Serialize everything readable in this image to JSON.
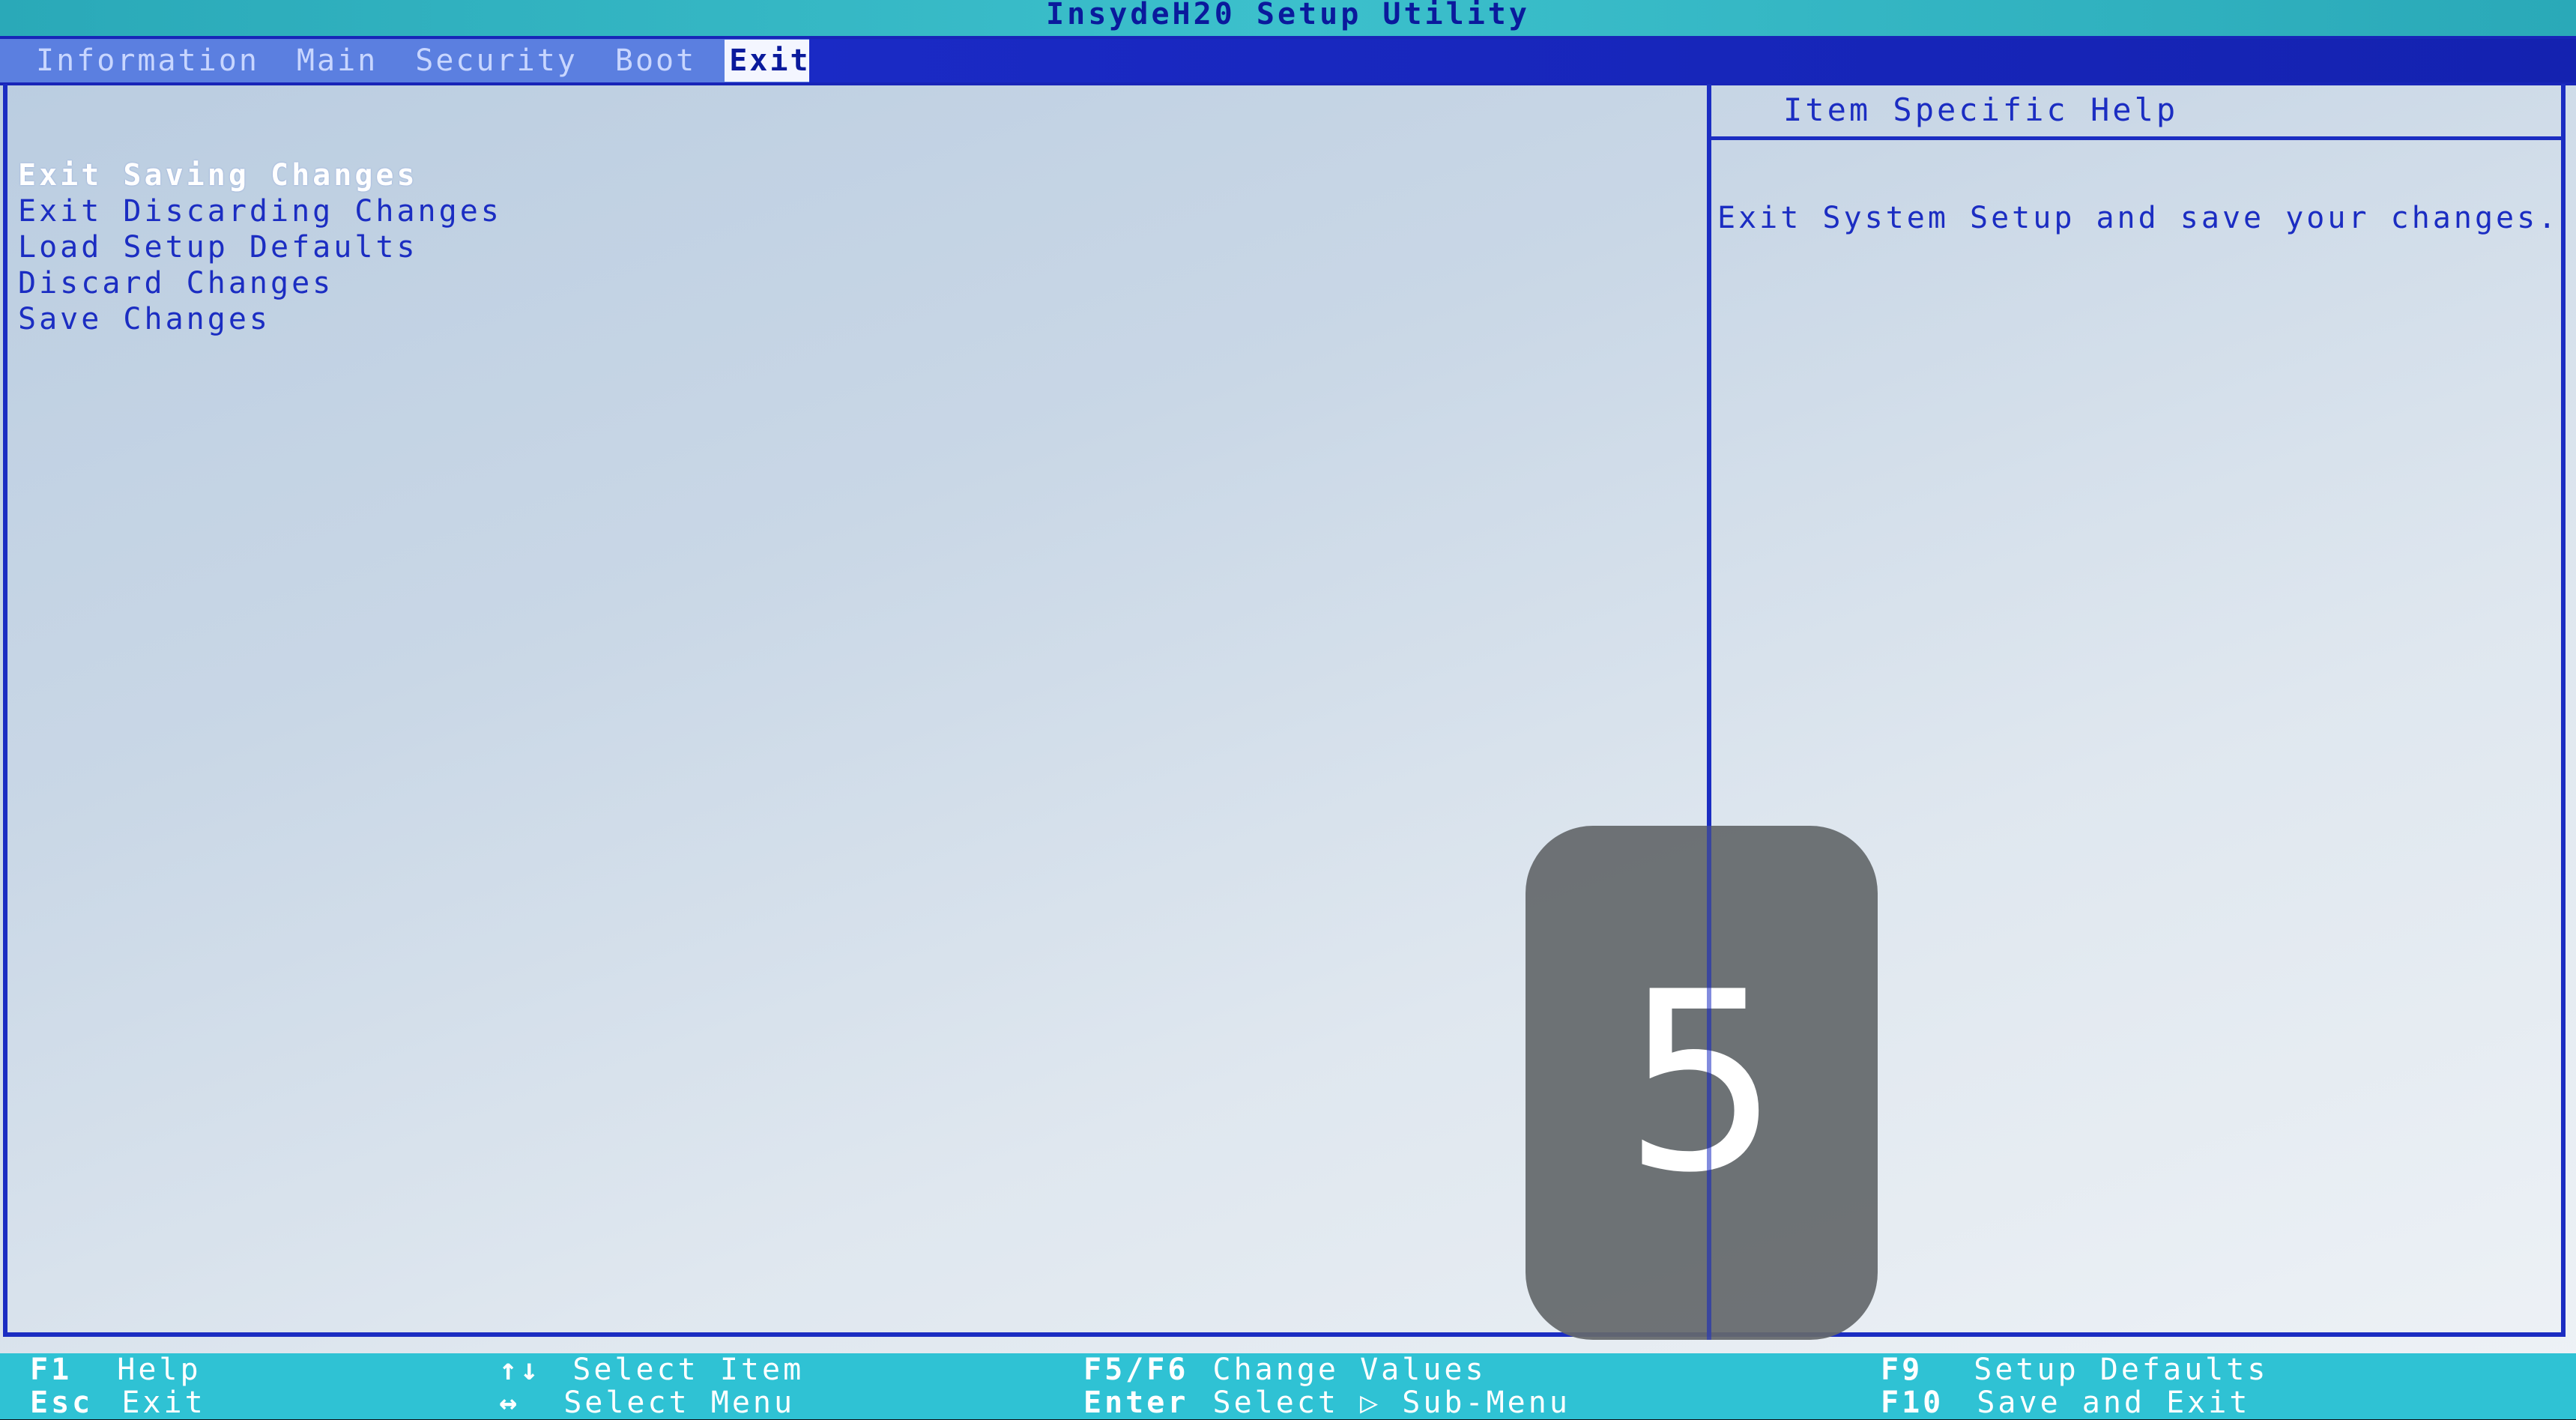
{
  "title": "InsydeH20 Setup Utility",
  "menu": {
    "tabs": [
      {
        "label": "Information"
      },
      {
        "label": "Main"
      },
      {
        "label": "Security"
      },
      {
        "label": "Boot"
      },
      {
        "label": "Exit",
        "active": true
      }
    ]
  },
  "items": [
    {
      "label": "Exit Saving Changes",
      "selected": true
    },
    {
      "label": "Exit Discarding Changes"
    },
    {
      "label": "Load Setup Defaults"
    },
    {
      "label": "Discard Changes"
    },
    {
      "label": "Save Changes"
    }
  ],
  "help": {
    "title": "Item Specific Help",
    "text": "Exit System Setup and save your changes."
  },
  "footer": {
    "f1": {
      "key": "F1",
      "desc": "Help"
    },
    "esc": {
      "key": "Esc",
      "desc": "Exit"
    },
    "updown": {
      "key": "↑↓",
      "desc": "Select Item"
    },
    "leftright": {
      "key": "↔",
      "desc": "Select Menu"
    },
    "f5f6": {
      "key": "F5/F6",
      "desc": "Change Values"
    },
    "enter": {
      "key": "Enter",
      "desc": "Select ▷ Sub-Menu"
    },
    "f9": {
      "key": "F9",
      "desc": "Setup Defaults"
    },
    "f10": {
      "key": "F10",
      "desc": "Save and Exit"
    }
  },
  "badge": {
    "value": "5"
  },
  "colors": {
    "bios_blue": "#1b2dc2",
    "title_bar": "#2aa9b8",
    "footer": "#2fc2d4",
    "background": "#c9d7e6"
  }
}
